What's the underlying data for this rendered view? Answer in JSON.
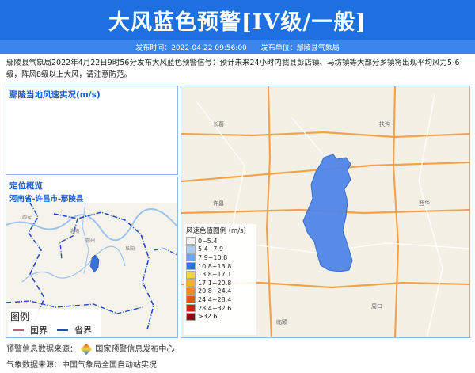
{
  "header": {
    "title": "大风蓝色预警[IV级/一般]",
    "publish_time": "发布时间：2022-04-22 09:56:00",
    "publisher": "发布单位：鄢陵县气象局"
  },
  "description": "鄢陵县气象局2022年4月22日9时56分发布大风蓝色预警信号：预计未来24小时内我县彭店镇、马坊镇等大部分乡镇将出现平均风力5-6级，阵风8级以上大风，请注意防范。",
  "wind_panel": {
    "title": "鄢陵当地风速实况(m/s)"
  },
  "location_panel": {
    "title": "定位概览",
    "region": "河南省-许昌市-鄢陵县",
    "legend_title": "图例",
    "legend_items": [
      {
        "label": "国界",
        "color": "#c0607a"
      },
      {
        "label": "省界",
        "color": "#1f4fbf"
      }
    ]
  },
  "wind_legend": {
    "title": "风速色值图例 (m/s)",
    "items": [
      {
        "label": "0~5.4",
        "color": "#f2f2f2"
      },
      {
        "label": "5.4~7.9",
        "color": "#a9cdf2"
      },
      {
        "label": "7.9~10.8",
        "color": "#6fa6ee"
      },
      {
        "label": "10.8~13.8",
        "color": "#2f6fe0"
      },
      {
        "label": "13.8~17.1",
        "color": "#f2d43c"
      },
      {
        "label": "17.1~20.8",
        "color": "#f5b32d"
      },
      {
        "label": "20.8~24.4",
        "color": "#f08a1e"
      },
      {
        "label": "24.4~28.4",
        "color": "#e4541a"
      },
      {
        "label": "28.4~32.6",
        "color": "#c9231a"
      },
      {
        "label": ">32.6",
        "color": "#8e0f12"
      }
    ]
  },
  "footer": {
    "warning_source_label": "预警信息数据来源：",
    "warning_source": "国家预警信息发布中心",
    "weather_source": "气象数据来源：中国气象局全国自动站实况"
  },
  "colors": {
    "header": "#1e6fe0",
    "meta": "#3a86ec",
    "county_fill": "#4f86e8"
  }
}
